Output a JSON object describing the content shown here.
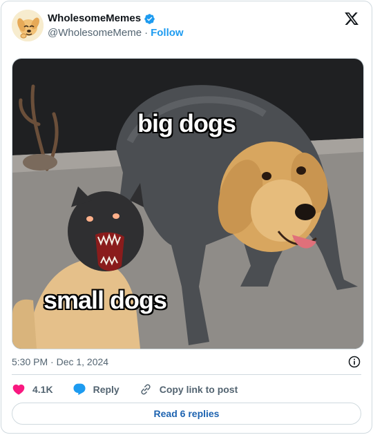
{
  "author": {
    "display_name": "WholesomeMemes",
    "handle": "@WholesomeMeme",
    "separator": "·",
    "follow_label": "Follow",
    "avatar_icon": "cartoon-dog-avatar-icon",
    "verified_icon": "verified-badge-icon"
  },
  "platform_icon": "x-logo-icon",
  "media": {
    "caption_top": "big dogs",
    "caption_bottom": "small dogs"
  },
  "timestamp": "5:30 PM · Dec 1, 2024",
  "info_icon": "info-icon",
  "actions": {
    "like_count": "4.1K",
    "reply_label": "Reply",
    "copy_label": "Copy link to post"
  },
  "read_replies_label": "Read 6 replies",
  "colors": {
    "accent": "#1d9bf0",
    "like": "#f91880",
    "text_secondary": "#536471",
    "border": "#cfd9de"
  }
}
